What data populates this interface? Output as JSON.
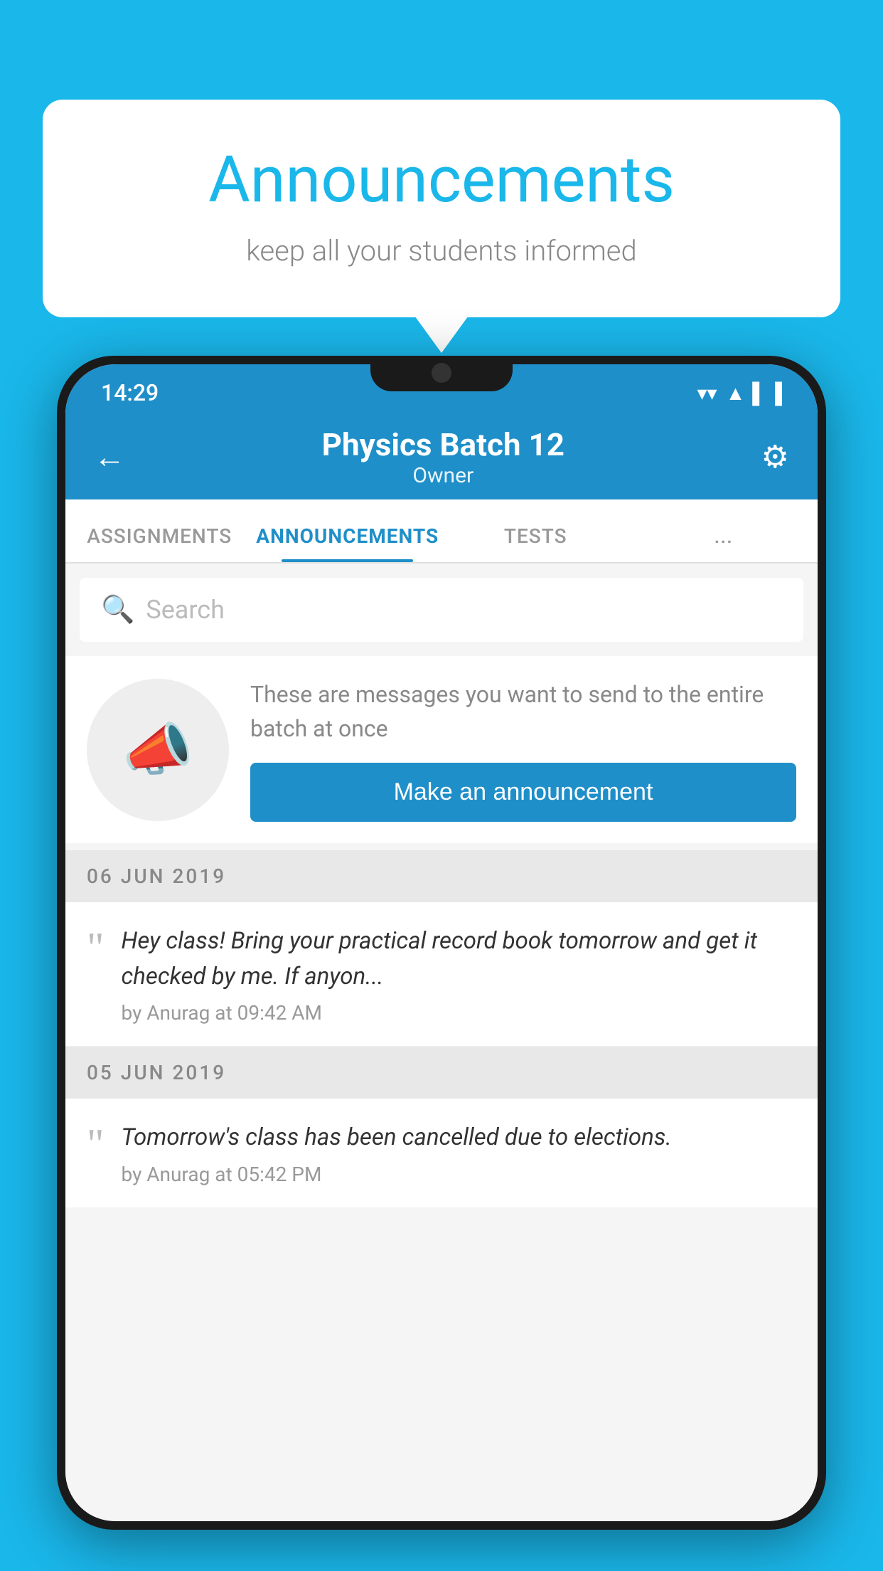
{
  "page": {
    "background_color": "#1ab7ea"
  },
  "speech_bubble": {
    "title": "Announcements",
    "subtitle": "keep all your students informed"
  },
  "status_bar": {
    "time": "14:29",
    "wifi": "▼",
    "signal": "▲",
    "battery": "▐"
  },
  "header": {
    "back_label": "←",
    "title": "Physics Batch 12",
    "subtitle": "Owner",
    "gear_label": "⚙"
  },
  "tabs": [
    {
      "label": "ASSIGNMENTS",
      "active": false
    },
    {
      "label": "ANNOUNCEMENTS",
      "active": true
    },
    {
      "label": "TESTS",
      "active": false
    },
    {
      "label": "...",
      "active": false
    }
  ],
  "search": {
    "placeholder": "Search"
  },
  "promo": {
    "description": "These are messages you want to send to the entire batch at once",
    "button_label": "Make an announcement"
  },
  "announcements": [
    {
      "date": "06  JUN  2019",
      "body": "Hey class! Bring your practical record book tomorrow and get it checked by me. If anyon...",
      "meta": "by Anurag at 09:42 AM"
    },
    {
      "date": "05  JUN  2019",
      "body": "Tomorrow's class has been cancelled due to elections.",
      "meta": "by Anurag at 05:42 PM"
    }
  ]
}
